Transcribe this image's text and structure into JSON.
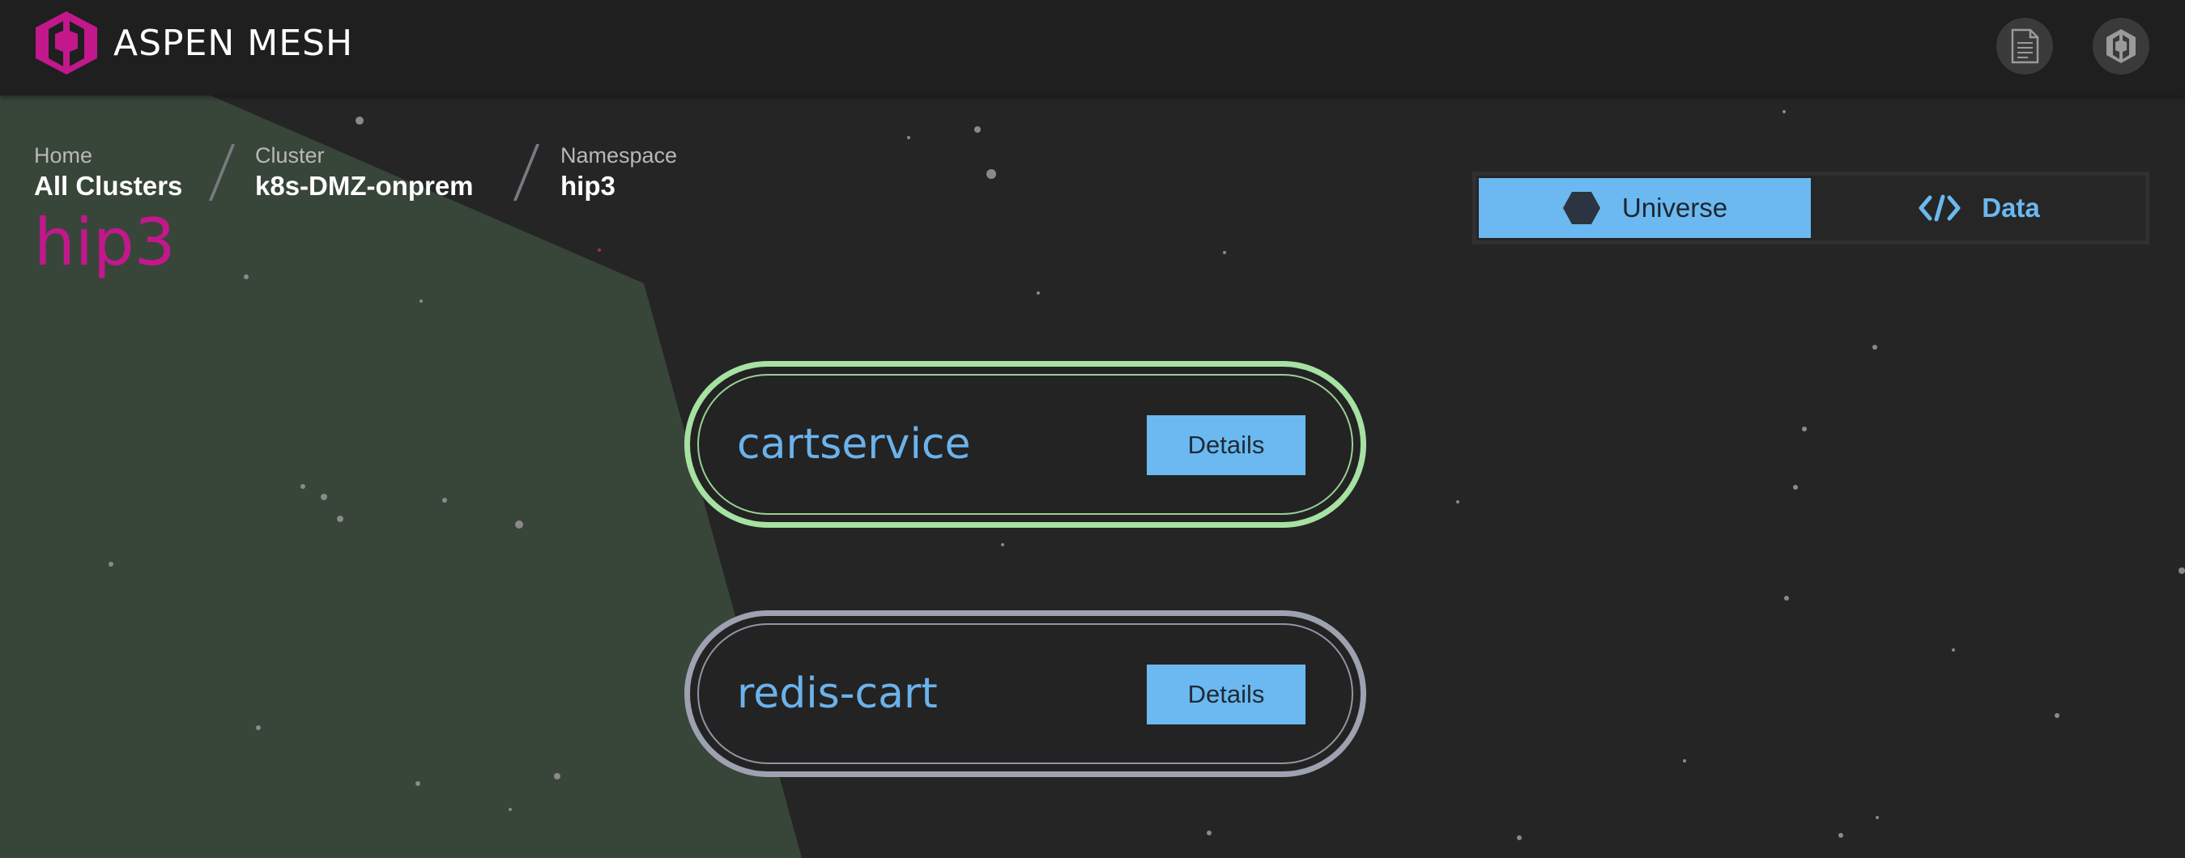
{
  "app": {
    "brand_name": "ASPEN MESH",
    "accent_color": "#c2188c",
    "link_color": "#6bb9f0"
  },
  "header": {
    "docs_icon": "document-icon",
    "profile_icon": "aspen-logo-icon"
  },
  "breadcrumb": {
    "home": {
      "label": "Home",
      "value": "All Clusters"
    },
    "cluster": {
      "label": "Cluster",
      "value": "k8s-DMZ-onprem"
    },
    "namespace": {
      "label": "Namespace",
      "value": "hip3"
    }
  },
  "page": {
    "title": "hip3"
  },
  "view_toggle": {
    "tabs": [
      {
        "label": "Universe",
        "icon": "hexagon-icon",
        "active": true
      },
      {
        "label": "Data",
        "icon": "code-icon",
        "active": false
      }
    ]
  },
  "services": [
    {
      "name": "cartservice",
      "details_label": "Details",
      "status_color": "#a6e2a2"
    },
    {
      "name": "redis-cart",
      "details_label": "Details",
      "status_color": "#9ea1b0"
    }
  ]
}
